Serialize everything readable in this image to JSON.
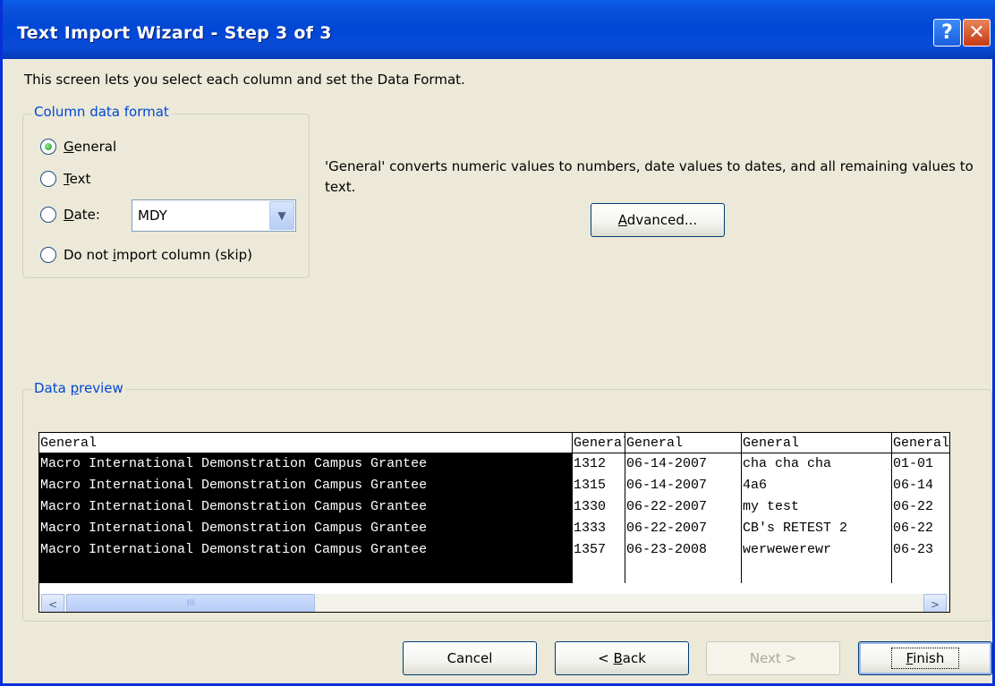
{
  "window": {
    "title": "Text Import Wizard - Step 3 of 3",
    "help_label": "?",
    "close_label": "✕"
  },
  "intro": "This screen lets you select each column and set the Data Format.",
  "column_format": {
    "legend": "Column data format",
    "general": {
      "pre": "",
      "accel": "G",
      "post": "eneral",
      "checked": true
    },
    "text": {
      "pre": "",
      "accel": "T",
      "post": "ext",
      "checked": false
    },
    "date": {
      "pre": "",
      "accel": "D",
      "post": "ate:",
      "checked": false
    },
    "skip": {
      "pre": "Do not ",
      "accel": "i",
      "post": "mport column (skip)",
      "checked": false
    },
    "date_value": "MDY"
  },
  "description": "'General' converts numeric values to numbers, date values to dates, and all remaining values to text.",
  "advanced": {
    "pre": "",
    "accel": "A",
    "post": "dvanced..."
  },
  "preview": {
    "legend_pre": "Data ",
    "legend_accel": "p",
    "legend_post": "review",
    "headers": [
      "General",
      "General",
      "General",
      "General",
      "General"
    ],
    "rows": [
      [
        "Macro International Demonstration Campus Grantee",
        "1312",
        "06-14-2007",
        "cha cha cha",
        "01-01"
      ],
      [
        "Macro International Demonstration Campus Grantee",
        "1315",
        "06-14-2007",
        "4a6",
        "06-14"
      ],
      [
        "Macro International Demonstration Campus Grantee",
        "1330",
        "06-22-2007",
        "my test",
        "06-22"
      ],
      [
        "Macro International Demonstration Campus Grantee",
        "1333",
        "06-22-2007",
        "CB's RETEST 2",
        "06-22"
      ],
      [
        "Macro International Demonstration Campus Grantee",
        "1357",
        "06-23-2008",
        "werwewerewr",
        "06-23"
      ]
    ],
    "scroll_up": "^",
    "scroll_down": "v",
    "scroll_left": "<",
    "scroll_right": ">",
    "grip_v": "≡",
    "grip_h": "III"
  },
  "buttons": {
    "cancel": "Cancel",
    "back": {
      "pre": "< ",
      "accel": "B",
      "post": "ack"
    },
    "next": "Next >",
    "finish": {
      "pre": "",
      "accel": "F",
      "post": "inish"
    }
  },
  "colors": {
    "title_bar": "#0a4fd8",
    "legend_text": "#0046d5",
    "dialog_bg": "#ece9d8"
  }
}
